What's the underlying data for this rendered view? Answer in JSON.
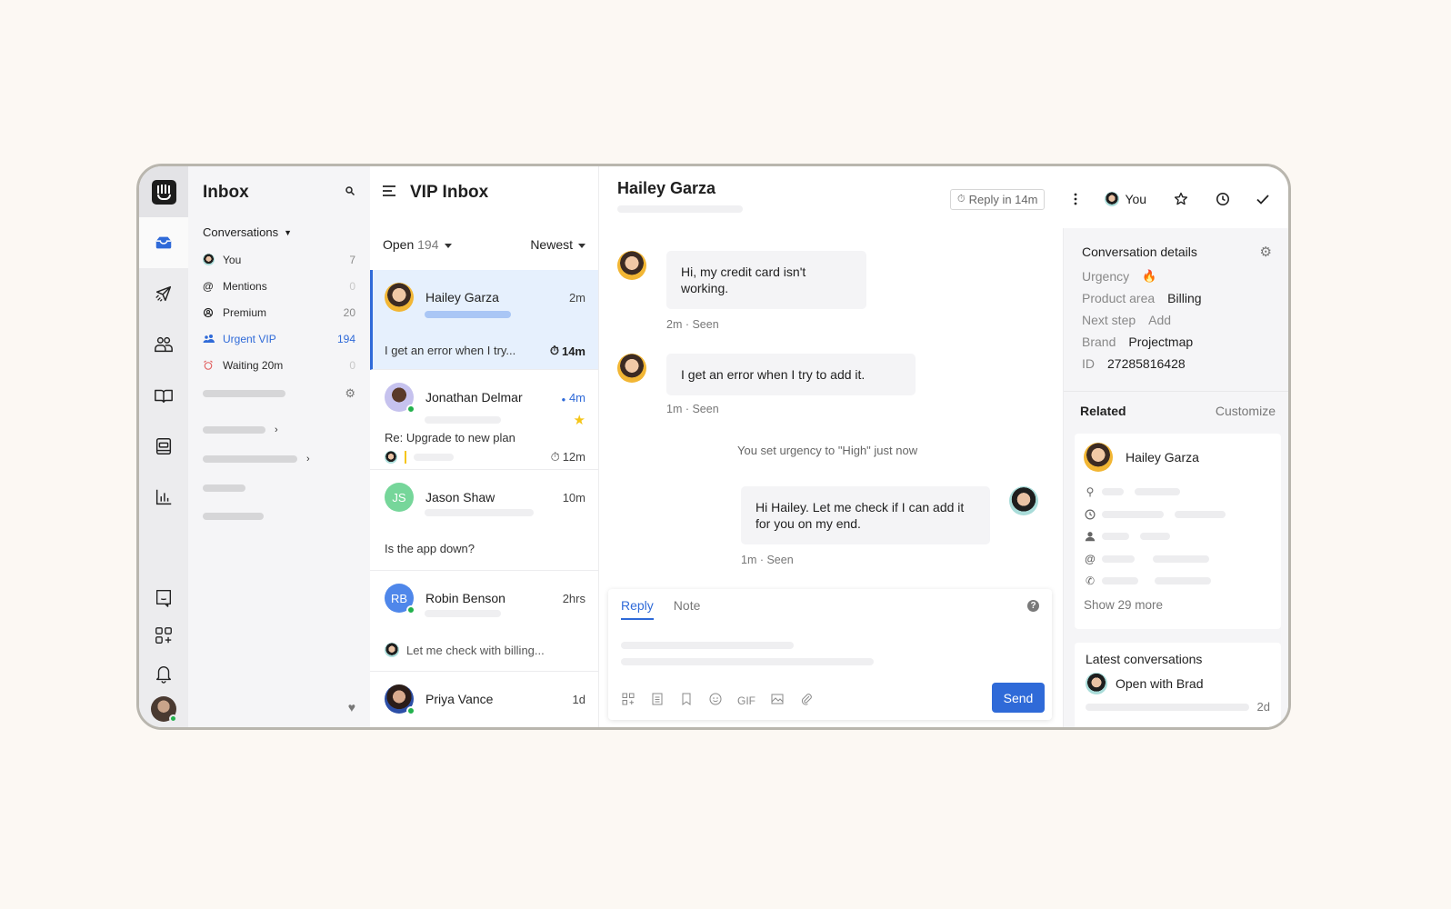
{
  "nav": {
    "title": "Inbox",
    "section_label": "Conversations",
    "items": [
      {
        "label": "You",
        "count": "7",
        "icon": "avatar"
      },
      {
        "label": "Mentions",
        "count": "0",
        "icon": "at-icon"
      },
      {
        "label": "Premium",
        "count": "20",
        "icon": "team-icon"
      },
      {
        "label": "Urgent VIP",
        "count": "194",
        "icon": "people-icon"
      },
      {
        "label": "Waiting 20m",
        "count": "0",
        "icon": "alarm-icon"
      }
    ]
  },
  "list": {
    "title": "VIP Inbox",
    "filter_state": "Open",
    "filter_count": "194",
    "sort": "Newest",
    "conversations": [
      {
        "name": "Hailey Garza",
        "time": "2m",
        "snippet": "I get an error when I try...",
        "sla": "14m"
      },
      {
        "name": "Jonathan Delmar",
        "time": "4m",
        "snippet": "Re: Upgrade to new plan",
        "sla": "12m"
      },
      {
        "name": "Jason Shaw",
        "initials": "JS",
        "time": "10m",
        "snippet": "Is the app down?"
      },
      {
        "name": "Robin Benson",
        "initials": "RB",
        "time": "2hrs",
        "snippet": "Let me check with billing..."
      },
      {
        "name": "Priya Vance",
        "time": "1d"
      }
    ]
  },
  "conversation": {
    "title": "Hailey Garza",
    "reply_in": "Reply in 14m",
    "assignee": "You",
    "messages": [
      {
        "text": "Hi, my credit card isn't working.",
        "meta": "2m · Seen"
      },
      {
        "text": "I get an error when I try to add it.",
        "meta": "1m · Seen"
      },
      {
        "text": "Hi Hailey. Let me check if I can add it for you on my end.",
        "meta": "1m · Seen"
      }
    ],
    "event": "You set urgency to \"High\" just now",
    "composer": {
      "tabs": [
        "Reply",
        "Note"
      ],
      "gif_label": "GIF",
      "send_label": "Send",
      "help": "?"
    }
  },
  "details": {
    "title": "Conversation details",
    "fields": [
      {
        "key": "Urgency",
        "value": "🔥"
      },
      {
        "key": "Product area",
        "value": "Billing"
      },
      {
        "key": "Next step",
        "value": "Add"
      },
      {
        "key": "Brand",
        "value": "Projectmap"
      },
      {
        "key": "ID",
        "value": "27285816428"
      }
    ],
    "related_title": "Related",
    "customize_label": "Customize",
    "contact_name": "Hailey Garza",
    "show_more": "Show 29 more",
    "latest_title": "Latest conversations",
    "latest_item": "Open with Brad",
    "latest_time": "2d"
  },
  "colors": {
    "accent": "#2f6ad8",
    "page_bg": "#fcf8f3",
    "online": "#22b14c",
    "star": "#f5c518"
  }
}
